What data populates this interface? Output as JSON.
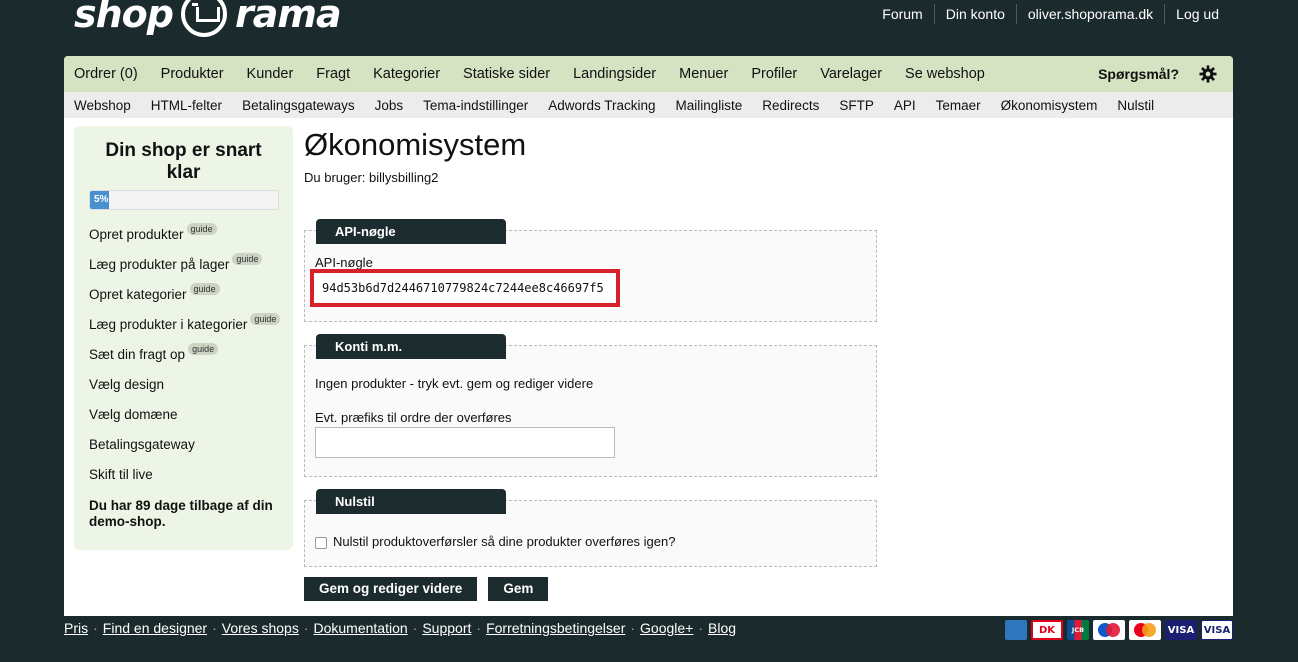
{
  "logo": {
    "part1": "shop",
    "part2": "rama"
  },
  "toplinks": [
    "Forum",
    "Din konto",
    "oliver.shoporama.dk",
    "Log ud"
  ],
  "nav1": {
    "items": [
      "Ordrer (0)",
      "Produkter",
      "Kunder",
      "Fragt",
      "Kategorier",
      "Statiske sider",
      "Landingsider",
      "Menuer",
      "Profiler",
      "Varelager",
      "Se webshop"
    ],
    "help": "Spørgsmål?"
  },
  "nav2": {
    "items": [
      "Webshop",
      "HTML-felter",
      "Betalingsgateways",
      "Jobs",
      "Tema-indstillinger",
      "Adwords Tracking",
      "Mailingliste",
      "Redirects",
      "SFTP",
      "API",
      "Temaer",
      "Økonomisystem",
      "Nulstil"
    ]
  },
  "sidebar": {
    "title": "Din shop er snart klar",
    "progress_label": "5%",
    "progress_value": 5,
    "guide_label": "guide",
    "items": [
      {
        "label": "Opret produkter",
        "guide": true
      },
      {
        "label": "Læg produkter på lager",
        "guide": true
      },
      {
        "label": "Opret kategorier",
        "guide": true
      },
      {
        "label": "Læg produkter i kategorier",
        "guide": true
      },
      {
        "label": "Sæt din fragt op",
        "guide": true
      },
      {
        "label": "Vælg design",
        "guide": false
      },
      {
        "label": "Vælg domæne",
        "guide": false
      },
      {
        "label": "Betalingsgateway",
        "guide": false
      },
      {
        "label": "Skift til live",
        "guide": false
      }
    ],
    "footer": "Du har 89 dage tilbage af din demo-shop."
  },
  "main": {
    "title": "Økonomisystem",
    "subtitle": "Du bruger: billysbilling2",
    "api_section": {
      "legend": "API-nøgle",
      "label": "API-nøgle",
      "value": "94d53b6d7d2446710779824c7244ee8c46697f5"
    },
    "accounts_section": {
      "legend": "Konti m.m.",
      "info": "Ingen produkter - tryk evt. gem og rediger videre",
      "prefix_label": "Evt. præfiks til ordre der overføres",
      "prefix_value": ""
    },
    "reset_section": {
      "legend": "Nulstil",
      "checkbox_label": "Nulstil produktoverførsler så dine produkter overføres igen?",
      "checked": false
    },
    "buttons": {
      "save_continue": "Gem og rediger videre",
      "save": "Gem"
    }
  },
  "footer": {
    "links": [
      "Pris",
      "Find en designer",
      "Vores shops",
      "Dokumentation",
      "Support",
      "Forretningsbetingelser",
      "Google+",
      "Blog"
    ]
  },
  "payment_cards": [
    "American Express",
    "DK",
    "JCB",
    "Maestro",
    "MasterCard",
    "VISA Electron",
    "VISA"
  ],
  "colors": {
    "background": "#1b2b2d",
    "nav_green": "#d5e3c3",
    "sidebar_green": "#edf6e6",
    "highlight_red": "#d8202a",
    "progress_blue": "#4a8fce"
  }
}
